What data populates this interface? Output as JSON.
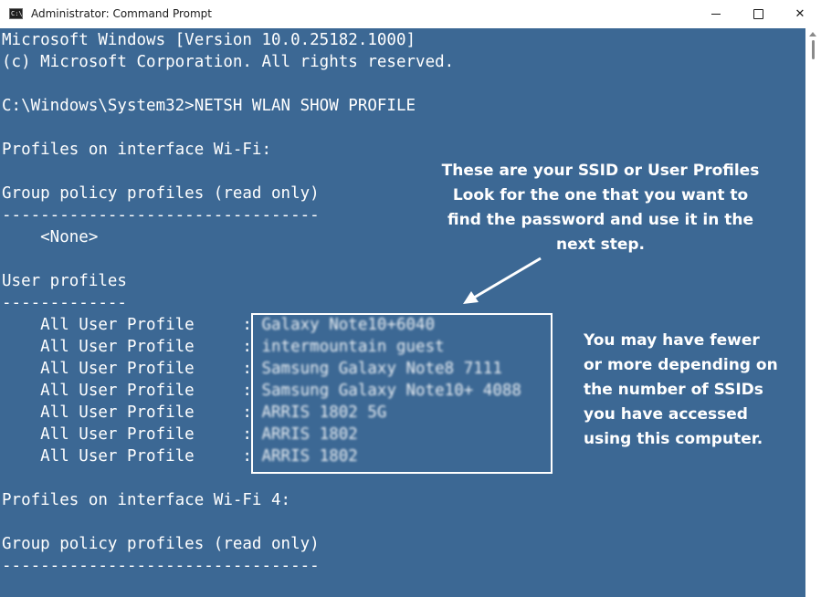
{
  "window": {
    "title": "Administrator: Command Prompt",
    "icon_name": "command-prompt-icon",
    "icon_text": "C:\\.",
    "buttons": [
      "minimize-icon",
      "maximize-icon",
      "close-icon"
    ],
    "close_glyph": "✕"
  },
  "colors": {
    "console_bg": "#3c6894",
    "text": "#ffffff",
    "titlebar_bg": "#ffffff"
  },
  "terminal": {
    "lines": [
      "Microsoft Windows [Version 10.0.25182.1000]",
      "(c) Microsoft Corporation. All rights reserved.",
      "",
      "C:\\Windows\\System32>NETSH WLAN SHOW PROFILE",
      "",
      "Profiles on interface Wi-Fi:",
      "",
      "Group policy profiles (read only)",
      "---------------------------------",
      "    <None>",
      "",
      "User profiles",
      "-------------",
      "    All User Profile     : ",
      "    All User Profile     : ",
      "    All User Profile     : ",
      "    All User Profile     : ",
      "    All User Profile     : ",
      "    All User Profile     : ",
      "    All User Profile     : ",
      "",
      "Profiles on interface Wi-Fi 4:",
      "",
      "Group policy profiles (read only)",
      "---------------------------------"
    ],
    "blurred_profiles": [
      "Galaxy Note10+6040",
      "intermountain guest",
      "Samsung Galaxy Note8 7111",
      "Samsung Galaxy Note10+ 4088",
      "ARRIS 1802 5G",
      "ARRIS 1802",
      "ARRIS 1802"
    ]
  },
  "annotations": {
    "note_top": [
      "These are your SSID or User Profiles",
      "Look for the one that you want to",
      "find the password and use it in the",
      "next step."
    ],
    "note_right": [
      "You may have fewer",
      "or more depending on",
      "the number of SSIDs",
      "you have accessed",
      "using this computer."
    ]
  }
}
